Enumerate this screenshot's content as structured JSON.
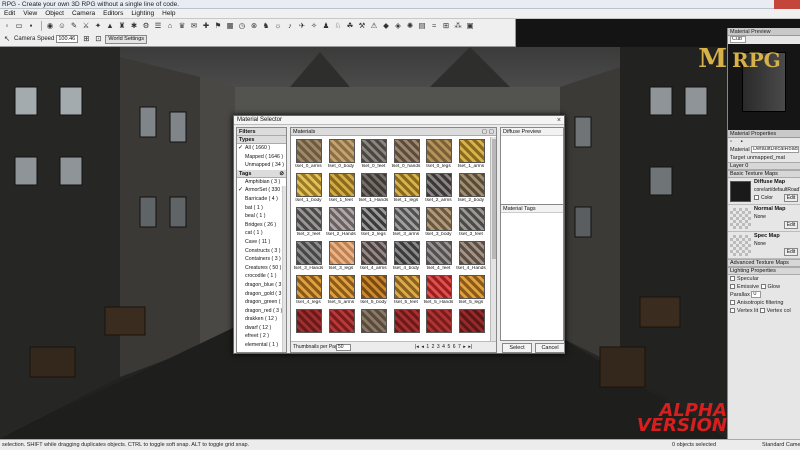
{
  "window": {
    "title": "RPG - Create your own 3D RPG without a single line of code."
  },
  "menu": [
    "Edit",
    "View",
    "Object",
    "Camera",
    "Editors",
    "Lighting",
    "Help"
  ],
  "toolbar": {
    "camera_speed_label": "Camera Speed",
    "camera_speed_value": "100.46",
    "world_settings_label": "World Settings"
  },
  "viewport": {
    "badge_line1": "ALPHA",
    "badge_line2": "VERSION",
    "logo_line1": "M",
    "logo_line2": "RPG"
  },
  "right_panel": {
    "preview_title": "Material Preview",
    "preview_shape": "Cub",
    "props_title": "Material Properties",
    "material_label": "Material",
    "material_value": "DefaultDecalRoadMaterial",
    "target_label": "Target",
    "target_value": "unmapped_mat",
    "layer_label": "Layer 0",
    "basic_maps": "Basic Texture Maps",
    "diffuse_title": "Diffuse Map",
    "diffuse_value": "core/art/defaultRoadTex",
    "color_label": "Color",
    "normal_title": "Normal Map",
    "normal_value": "None",
    "spec_title": "Spec Map",
    "spec_value": "None",
    "edit_label": "Edit",
    "advanced_maps": "Advanced Texture Maps",
    "lighting_props": "Lighting Properties",
    "specular_label": "Specular",
    "emissive_label": "Emissive",
    "glow_label": "Glow",
    "parallax_label": "Parallax",
    "parallax_value": "0",
    "aniso_label": "Anisotropic filtering",
    "vertex_label": "Vertex lit",
    "vertex_color_label": "Vertex col"
  },
  "status": {
    "left": "selection. SHIFT while dragging duplicates objects. CTRL to toggle soft snap. ALT to toggle grid snap.",
    "count": "0 objects selected",
    "mode": "Standard Camera"
  },
  "dialog": {
    "title": "Material Selector",
    "close": "×",
    "filters_title": "Filters",
    "types_title": "Types",
    "types": [
      {
        "label": "All ( 1660 )",
        "checked": true
      },
      {
        "label": "Mapped ( 1646 )",
        "checked": false
      },
      {
        "label": "Unmapped ( 34 )",
        "checked": false
      }
    ],
    "tags_title": "Tags",
    "tags": [
      {
        "label": "Amphibian ( 3 )",
        "checked": false
      },
      {
        "label": "ArmorSet ( 330 )",
        "checked": true
      },
      {
        "label": "Barricade ( 4 )",
        "checked": false
      },
      {
        "label": "bat ( 1 )",
        "checked": false
      },
      {
        "label": "beal ( 1 )",
        "checked": false
      },
      {
        "label": "Bridges ( 26 )",
        "checked": false
      },
      {
        "label": "cat ( 1 )",
        "checked": false
      },
      {
        "label": "Cave ( 11 )",
        "checked": false
      },
      {
        "label": "Constructs ( 3 )",
        "checked": false
      },
      {
        "label": "Containers ( 3 )",
        "checked": false
      },
      {
        "label": "Creatures ( 50 )",
        "checked": false
      },
      {
        "label": "crocodile ( 1 )",
        "checked": false
      },
      {
        "label": "dragon_blue ( 3 )",
        "checked": false
      },
      {
        "label": "dragon_gold ( 3 )",
        "checked": false
      },
      {
        "label": "dragon_green ( 3 )",
        "checked": false
      },
      {
        "label": "dragon_red ( 3 )",
        "checked": false
      },
      {
        "label": "drakken ( 12 )",
        "checked": false
      },
      {
        "label": "dwarf ( 12 )",
        "checked": false
      },
      {
        "label": "efreet ( 2 )",
        "checked": false
      },
      {
        "label": "elemental ( 1 )",
        "checked": false
      }
    ],
    "materials_title": "Materials",
    "materials": [
      {
        "label": "tset_0_arms",
        "c1": "#6d5a43",
        "c2": "#a08a66"
      },
      {
        "label": "tset_0_body",
        "c1": "#8a6f49",
        "c2": "#c4a36e"
      },
      {
        "label": "tset_0_feet",
        "c1": "#4a4642",
        "c2": "#8c8680"
      },
      {
        "label": "tset_0_hands",
        "c1": "#5c4c3c",
        "c2": "#a08870"
      },
      {
        "label": "tset_0_legs",
        "c1": "#7a6038",
        "c2": "#b8935a"
      },
      {
        "label": "tset_1_arms",
        "c1": "#8a6a1e",
        "c2": "#d8b24a"
      },
      {
        "label": "tset_1_body",
        "c1": "#9a7a26",
        "c2": "#e2c05a"
      },
      {
        "label": "tset_1_feet",
        "c1": "#8a6a1e",
        "c2": "#d4ac44"
      },
      {
        "label": "tset_1_Hands",
        "c1": "#3e3a36",
        "c2": "#77706a"
      },
      {
        "label": "tset_1_legs",
        "c1": "#8a6a1e",
        "c2": "#d8b24a"
      },
      {
        "label": "tset_2_arms",
        "c1": "#3a3838",
        "c2": "#8a8484"
      },
      {
        "label": "tset_2_body",
        "c1": "#5a4a3a",
        "c2": "#a09070"
      },
      {
        "label": "tset_2_feet",
        "c1": "#4a4848",
        "c2": "#9a9696"
      },
      {
        "label": "tset_2_Hands",
        "c1": "#6a6060",
        "c2": "#b0a8a8"
      },
      {
        "label": "tset_2_legs",
        "c1": "#3a3a3a",
        "c2": "#9a9a9a"
      },
      {
        "label": "tset_3_arms",
        "c1": "#505050",
        "c2": "#a0a0a0"
      },
      {
        "label": "tset_3_body",
        "c1": "#6a5840",
        "c2": "#b09a78"
      },
      {
        "label": "tset_3_feet",
        "c1": "#4c4a48",
        "c2": "#9c9894"
      },
      {
        "label": "tset_3_Hands",
        "c1": "#484848",
        "c2": "#8e8e8e"
      },
      {
        "label": "tset_3_legs",
        "c1": "#c08050",
        "c2": "#e8b48a"
      },
      {
        "label": "tset_4_arms",
        "c1": "#4a4040",
        "c2": "#968a88"
      },
      {
        "label": "tset_4_body",
        "c1": "#3a3a3a",
        "c2": "#8a8a8a"
      },
      {
        "label": "tset_4_feet",
        "c1": "#545050",
        "c2": "#9a9494"
      },
      {
        "label": "tset_4_Hands",
        "c1": "#5a4e44",
        "c2": "#a49484"
      },
      {
        "label": "tset_4_legs",
        "c1": "#8a5a18",
        "c2": "#e0a040"
      },
      {
        "label": "tset_5_arms",
        "c1": "#8a5a18",
        "c2": "#e0a040"
      },
      {
        "label": "tset_5_body",
        "c1": "#7a4a10",
        "c2": "#cc8a30"
      },
      {
        "label": "tset_5_feet",
        "c1": "#8a6220",
        "c2": "#dcaa48"
      },
      {
        "label": "tset_5_Hands",
        "c1": "#9a2020",
        "c2": "#e05050"
      },
      {
        "label": "tset_5_legs",
        "c1": "#8a5a18",
        "c2": "#e0a040"
      },
      {
        "label": "",
        "c1": "#6a1a1a",
        "c2": "#a03030"
      },
      {
        "label": "",
        "c1": "#7a1c1c",
        "c2": "#b83a3a"
      },
      {
        "label": "",
        "c1": "#5a4a3a",
        "c2": "#8a7a6a"
      },
      {
        "label": "",
        "c1": "#6a1a1a",
        "c2": "#a83030"
      },
      {
        "label": "",
        "c1": "#7a1c1c",
        "c2": "#b03434"
      },
      {
        "label": "",
        "c1": "#5a1818",
        "c2": "#9a2a2a"
      }
    ],
    "thumbs_label": "Thumbnails per Page",
    "thumbs_value": "50",
    "pages": [
      "|◂",
      "◂",
      "1",
      "2",
      "3",
      "4",
      "5",
      "6",
      "7",
      "▸",
      "▸|"
    ],
    "preview_title": "Diffuse Preview",
    "tags_box_title": "Material Tags",
    "select_label": "Select",
    "cancel_label": "Cancel"
  }
}
